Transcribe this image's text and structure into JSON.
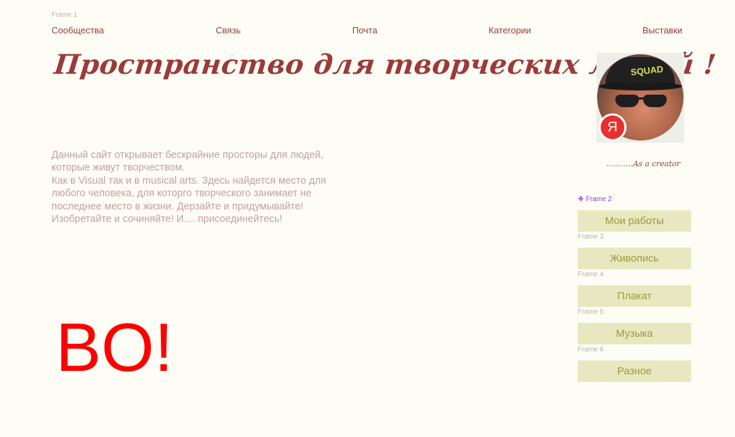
{
  "frames": {
    "frame1": "Frame 1",
    "frame2": "❖ Frame 2",
    "frame3": "Frame 3",
    "frame4": "Frame 4",
    "frame5": "Frame 5",
    "frame6": "Frame 6"
  },
  "nav": {
    "items": [
      {
        "label": "Сообщества"
      },
      {
        "label": "Связь"
      },
      {
        "label": "Почта"
      },
      {
        "label": "Категории"
      },
      {
        "label": "Выставки"
      }
    ]
  },
  "hero": {
    "title": "Пространство для творческих людей !"
  },
  "profile": {
    "cap_text": "SQUAD",
    "badge_letter": "Я",
    "tagline": "...........As a creator"
  },
  "description": {
    "text": "Данный сайт открывает бескрайние просторы для людей,\nкоторые живут творчеством.\nКак в Visual так и в musical arts. Здесь найдется место для\nлюбого человека, для которго творческого занимает не\nпоследнее место в жизни. Дерзайте и придумывайте!\nИзобретайте и сочиняйте! И....  присоединейтесь!"
  },
  "big_text": "BO!",
  "sidebar": {
    "buttons": [
      {
        "label": "Мои работы"
      },
      {
        "label": "Живопись"
      },
      {
        "label": "Плакат"
      },
      {
        "label": "Музыка"
      },
      {
        "label": "Разное"
      }
    ]
  },
  "colors": {
    "background": "#fdfdf5",
    "accent": "#9b3a3a",
    "big_text": "#ff0000",
    "button_bg": "#e8e8c0",
    "button_text": "#9a9a3a",
    "selection": "#8a3cf0"
  }
}
